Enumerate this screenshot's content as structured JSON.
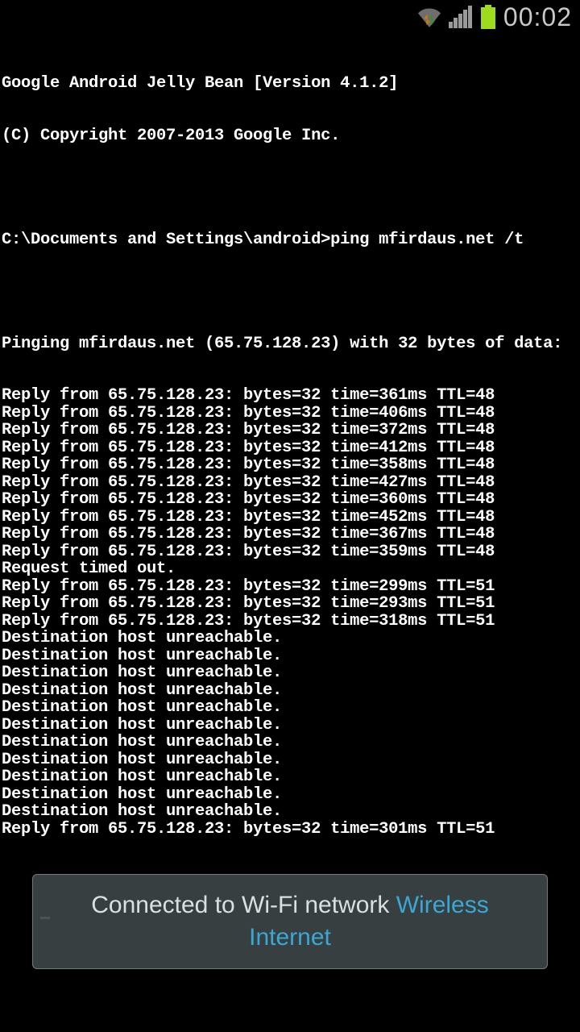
{
  "status": {
    "time": "00:02"
  },
  "terminal": {
    "header1": "Google Android Jelly Bean [Version 4.1.2]",
    "header2": "(C) Copyright 2007-2013 Google Inc.",
    "prompt": "C:\\Documents and Settings\\android>ping mfirdaus.net /t",
    "pinging": "Pinging mfirdaus.net (65.75.128.23) with 32 bytes of data:",
    "lines": [
      "Reply from 65.75.128.23: bytes=32 time=361ms TTL=48",
      "Reply from 65.75.128.23: bytes=32 time=406ms TTL=48",
      "Reply from 65.75.128.23: bytes=32 time=372ms TTL=48",
      "Reply from 65.75.128.23: bytes=32 time=412ms TTL=48",
      "Reply from 65.75.128.23: bytes=32 time=358ms TTL=48",
      "Reply from 65.75.128.23: bytes=32 time=427ms TTL=48",
      "Reply from 65.75.128.23: bytes=32 time=360ms TTL=48",
      "Reply from 65.75.128.23: bytes=32 time=452ms TTL=48",
      "Reply from 65.75.128.23: bytes=32 time=367ms TTL=48",
      "Reply from 65.75.128.23: bytes=32 time=359ms TTL=48",
      "Request timed out.",
      "Reply from 65.75.128.23: bytes=32 time=299ms TTL=51",
      "Reply from 65.75.128.23: bytes=32 time=293ms TTL=51",
      "Reply from 65.75.128.23: bytes=32 time=318ms TTL=51",
      "Destination host unreachable.",
      "Destination host unreachable.",
      "Destination host unreachable.",
      "Destination host unreachable.",
      "Destination host unreachable.",
      "Destination host unreachable.",
      "Destination host unreachable.",
      "Destination host unreachable.",
      "Destination host unreachable.",
      "Destination host unreachable.",
      "Destination host unreachable.",
      "Reply from 65.75.128.23: bytes=32 time=301ms TTL=51"
    ]
  },
  "toast": {
    "prefix": "Connected to Wi-Fi network ",
    "network": "Wireless Internet"
  }
}
